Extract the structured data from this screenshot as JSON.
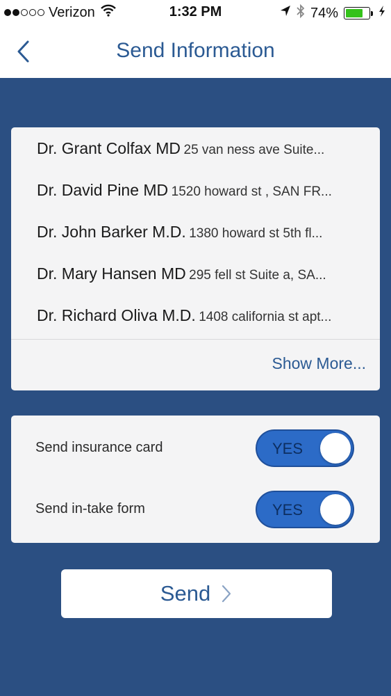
{
  "status_bar": {
    "carrier": "Verizon",
    "signal_dots_filled": 2,
    "signal_dots_total": 5,
    "time": "1:32 PM",
    "battery_percent": "74%",
    "battery_level": 0.74,
    "battery_color": "#34c21a",
    "icons": [
      "wifi-icon",
      "location-arrow-icon",
      "bluetooth-icon",
      "battery-icon",
      "charging-bolt-icon"
    ]
  },
  "nav": {
    "title": "Send Information",
    "back_icon": "chevron-left-icon"
  },
  "doctors": [
    {
      "name": "Dr. Grant Colfax MD",
      "address": "25 van ness ave Suite..."
    },
    {
      "name": "Dr. David Pine MD",
      "address": "1520 howard st , SAN FR..."
    },
    {
      "name": "Dr. John Barker M.D.",
      "address": "1380 howard st 5th fl..."
    },
    {
      "name": "Dr. Mary Hansen MD",
      "address": "295 fell st Suite a, SA..."
    },
    {
      "name": "Dr. Richard Oliva M.D.",
      "address": "1408 california st apt..."
    }
  ],
  "show_more_label": "Show More...",
  "options": {
    "insurance": {
      "label": "Send insurance card",
      "toggle_label": "YES",
      "on": true
    },
    "intake": {
      "label": "Send in-take form",
      "toggle_label": "YES",
      "on": true
    }
  },
  "send_button": {
    "label": "Send",
    "icon": "chevron-right-icon"
  },
  "colors": {
    "background": "#2b4f82",
    "accent": "#2b5a93",
    "toggle_on": "#2c6bc7"
  }
}
